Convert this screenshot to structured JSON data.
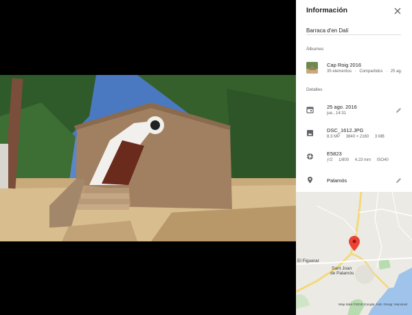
{
  "panel": {
    "title": "Información",
    "description": "Barraca d'en Dalí"
  },
  "albums": {
    "label": "Álbumes",
    "items": [
      {
        "title": "Cap Roig 2016",
        "count": "35 elementos",
        "sharing": "Compartidos",
        "date": "25 ag."
      }
    ]
  },
  "details": {
    "label": "Detalles",
    "date": {
      "title": "25 ago. 2016",
      "sub": "jue., 14:31",
      "icon": "calendar-icon"
    },
    "file": {
      "title": "DSC_1612.JPG",
      "megapixels": "8.3 MP",
      "resolution": "3840 × 2160",
      "size": "3 MB",
      "icon": "image-icon"
    },
    "camera": {
      "title": "E5823",
      "aperture": "ƒ/2",
      "shutter": "1/800",
      "focal": "4.23 mm",
      "iso": "ISO40",
      "icon": "aperture-icon"
    },
    "location": {
      "title": "Palamós",
      "icon": "location-pin-icon"
    }
  },
  "map": {
    "label_figuerar": "El Figuerar",
    "label_sant_joan_1": "Sant Joan",
    "label_sant_joan_2": "de Palamós",
    "attribution": "Map data ©2018 Google, Inst. Geogr. Nacional"
  },
  "colors": {
    "accent": "#1a73e8",
    "pin": "#ea4335"
  }
}
